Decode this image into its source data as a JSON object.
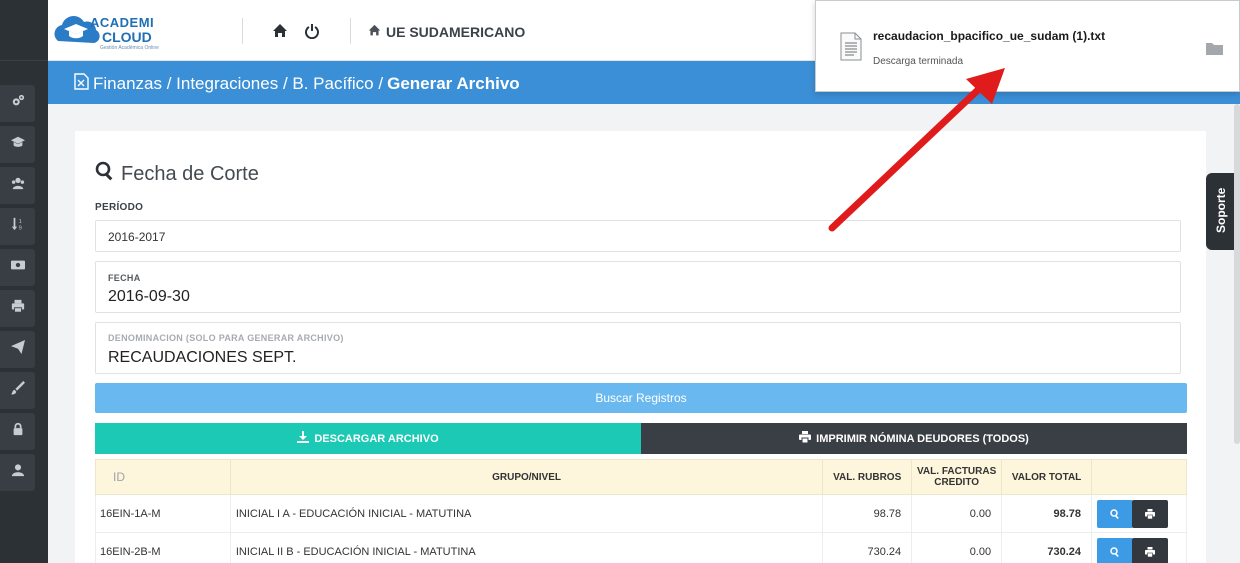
{
  "header": {
    "logo_line1": "ACADEMI",
    "logo_line2": "CLOUD",
    "logo_line3": "Gestión Académica Online",
    "institution": "UE SUDAMERICANO"
  },
  "breadcrumb": {
    "part1": "Finanzas / Integraciones / B. Pacífico /",
    "current": "Generar Archivo"
  },
  "section": {
    "title": "Fecha de Corte",
    "periodo_label": "PERÍODO",
    "periodo_value": "2016-2017",
    "fecha_label": "FECHA",
    "fecha_value": "2016-09-30",
    "denom_label": "DENOMINACION (SOLO PARA GENERAR ARCHIVO)",
    "denom_value": "RECAUDACIONES SEPT."
  },
  "buttons": {
    "buscar": "Buscar Registros",
    "descargar": "DESCARGAR ARCHIVO",
    "imprimir": "IMPRIMIR NÓMINA DEUDORES (TODOS)"
  },
  "table": {
    "headers": {
      "id": "ID",
      "grupo": "GRUPO/NIVEL",
      "val_rubros": "VAL. RUBROS",
      "val_facturas": "VAL. FACTURAS CREDITO",
      "valor_total": "VALOR TOTAL"
    },
    "rows": [
      {
        "id": "16EIN-1A-M",
        "grupo": "INICIAL I A - EDUCACIÓN INICIAL - MATUTINA",
        "val_rubros": "98.78",
        "val_facturas": "0.00",
        "valor_total": "98.78"
      },
      {
        "id": "16EIN-2B-M",
        "grupo": "INICIAL II B - EDUCACIÓN INICIAL - MATUTINA",
        "val_rubros": "730.24",
        "val_facturas": "0.00",
        "valor_total": "730.24"
      }
    ]
  },
  "soporte": "Soporte",
  "download": {
    "filename": "recaudacion_bpacifico_ue_sudam (1).txt",
    "status": "Descarga terminada"
  },
  "colors": {
    "accent_blue": "#3b8fd6",
    "teal": "#1bc9b4",
    "dark": "#3a3f45",
    "annotation_arrow": "#e01b1b"
  },
  "icons": {
    "sidebar": [
      "cogs-icon",
      "graduation-cap-icon",
      "users-icon",
      "sort-icon",
      "money-icon",
      "print-icon",
      "paper-plane-icon",
      "paint-brush-icon",
      "lock-icon",
      "user-icon"
    ]
  }
}
